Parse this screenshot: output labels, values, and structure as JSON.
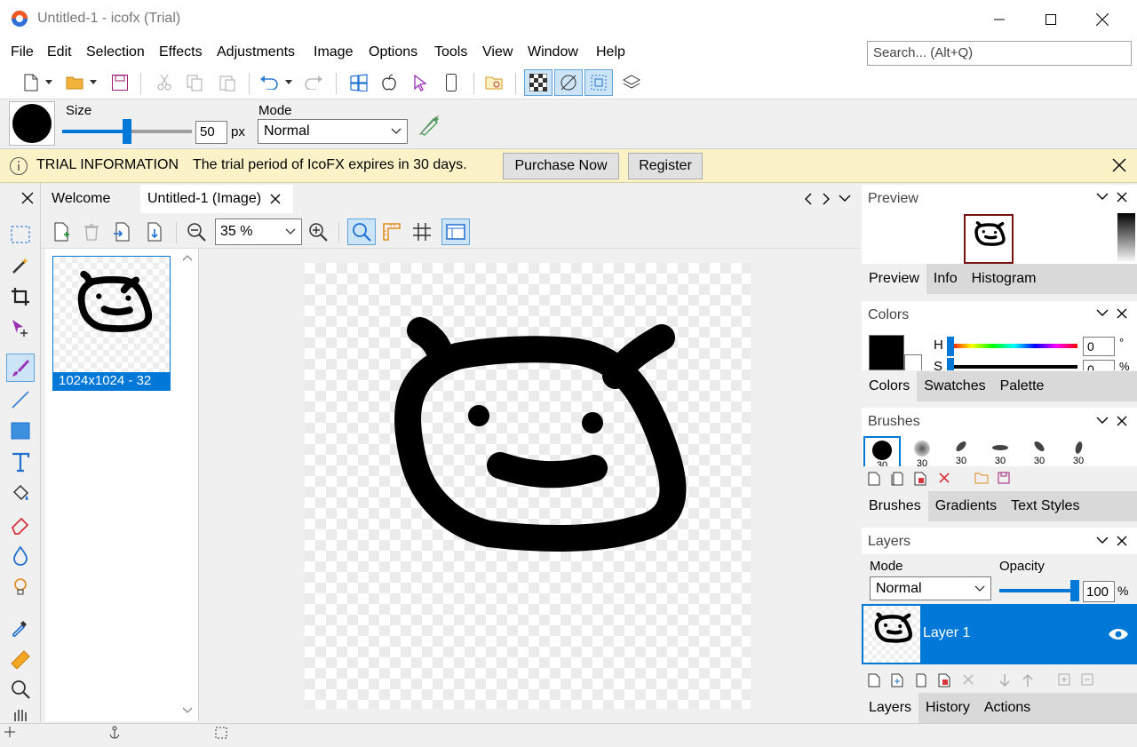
{
  "app": {
    "title": "Untitled-1 - icofx (Trial)"
  },
  "menu": [
    "File",
    "Edit",
    "Selection",
    "Effects",
    "Adjustments",
    "Image",
    "Options",
    "Tools",
    "View",
    "Window",
    "Help"
  ],
  "search": {
    "placeholder": "Search... (Alt+Q)"
  },
  "brush_options": {
    "size_label": "Size",
    "size_value": "50",
    "size_unit": "px",
    "size_slider_fraction": 0.5,
    "mode_label": "Mode",
    "mode_value": "Normal"
  },
  "trial": {
    "title": "TRIAL INFORMATION",
    "message": "The trial period of IcoFX expires in 30 days.",
    "purchase_label": "Purchase Now",
    "register_label": "Register"
  },
  "doc_tabs": [
    {
      "label": "Welcome"
    },
    {
      "label": "Untitled-1 (Image)"
    }
  ],
  "zoom": {
    "value": "35 %"
  },
  "thumbnail": {
    "label": "1024x1024 - 32"
  },
  "preview": {
    "title": "Preview",
    "tabs": [
      "Preview",
      "Info",
      "Histogram"
    ]
  },
  "colors": {
    "title": "Colors",
    "h_label": "H",
    "s_label": "S",
    "h_value": "0",
    "h_unit": "°",
    "s_value": "0",
    "s_unit": "%",
    "tabs": [
      "Colors",
      "Swatches",
      "Palette"
    ]
  },
  "brushes": {
    "title": "Brushes",
    "sizes": [
      "30",
      "30",
      "30",
      "30",
      "30",
      "30"
    ],
    "tabs": [
      "Brushes",
      "Gradients",
      "Text Styles"
    ]
  },
  "layers": {
    "title": "Layers",
    "mode_label": "Mode",
    "mode_value": "Normal",
    "opacity_label": "Opacity",
    "opacity_value": "100",
    "opacity_unit": "%",
    "opacity_fraction": 1.0,
    "layer_name": "Layer 1",
    "tabs": [
      "Layers",
      "History",
      "Actions"
    ]
  },
  "colors_theme": {
    "accent": "#0078d7",
    "trial_bg": "#fbf3c7"
  }
}
